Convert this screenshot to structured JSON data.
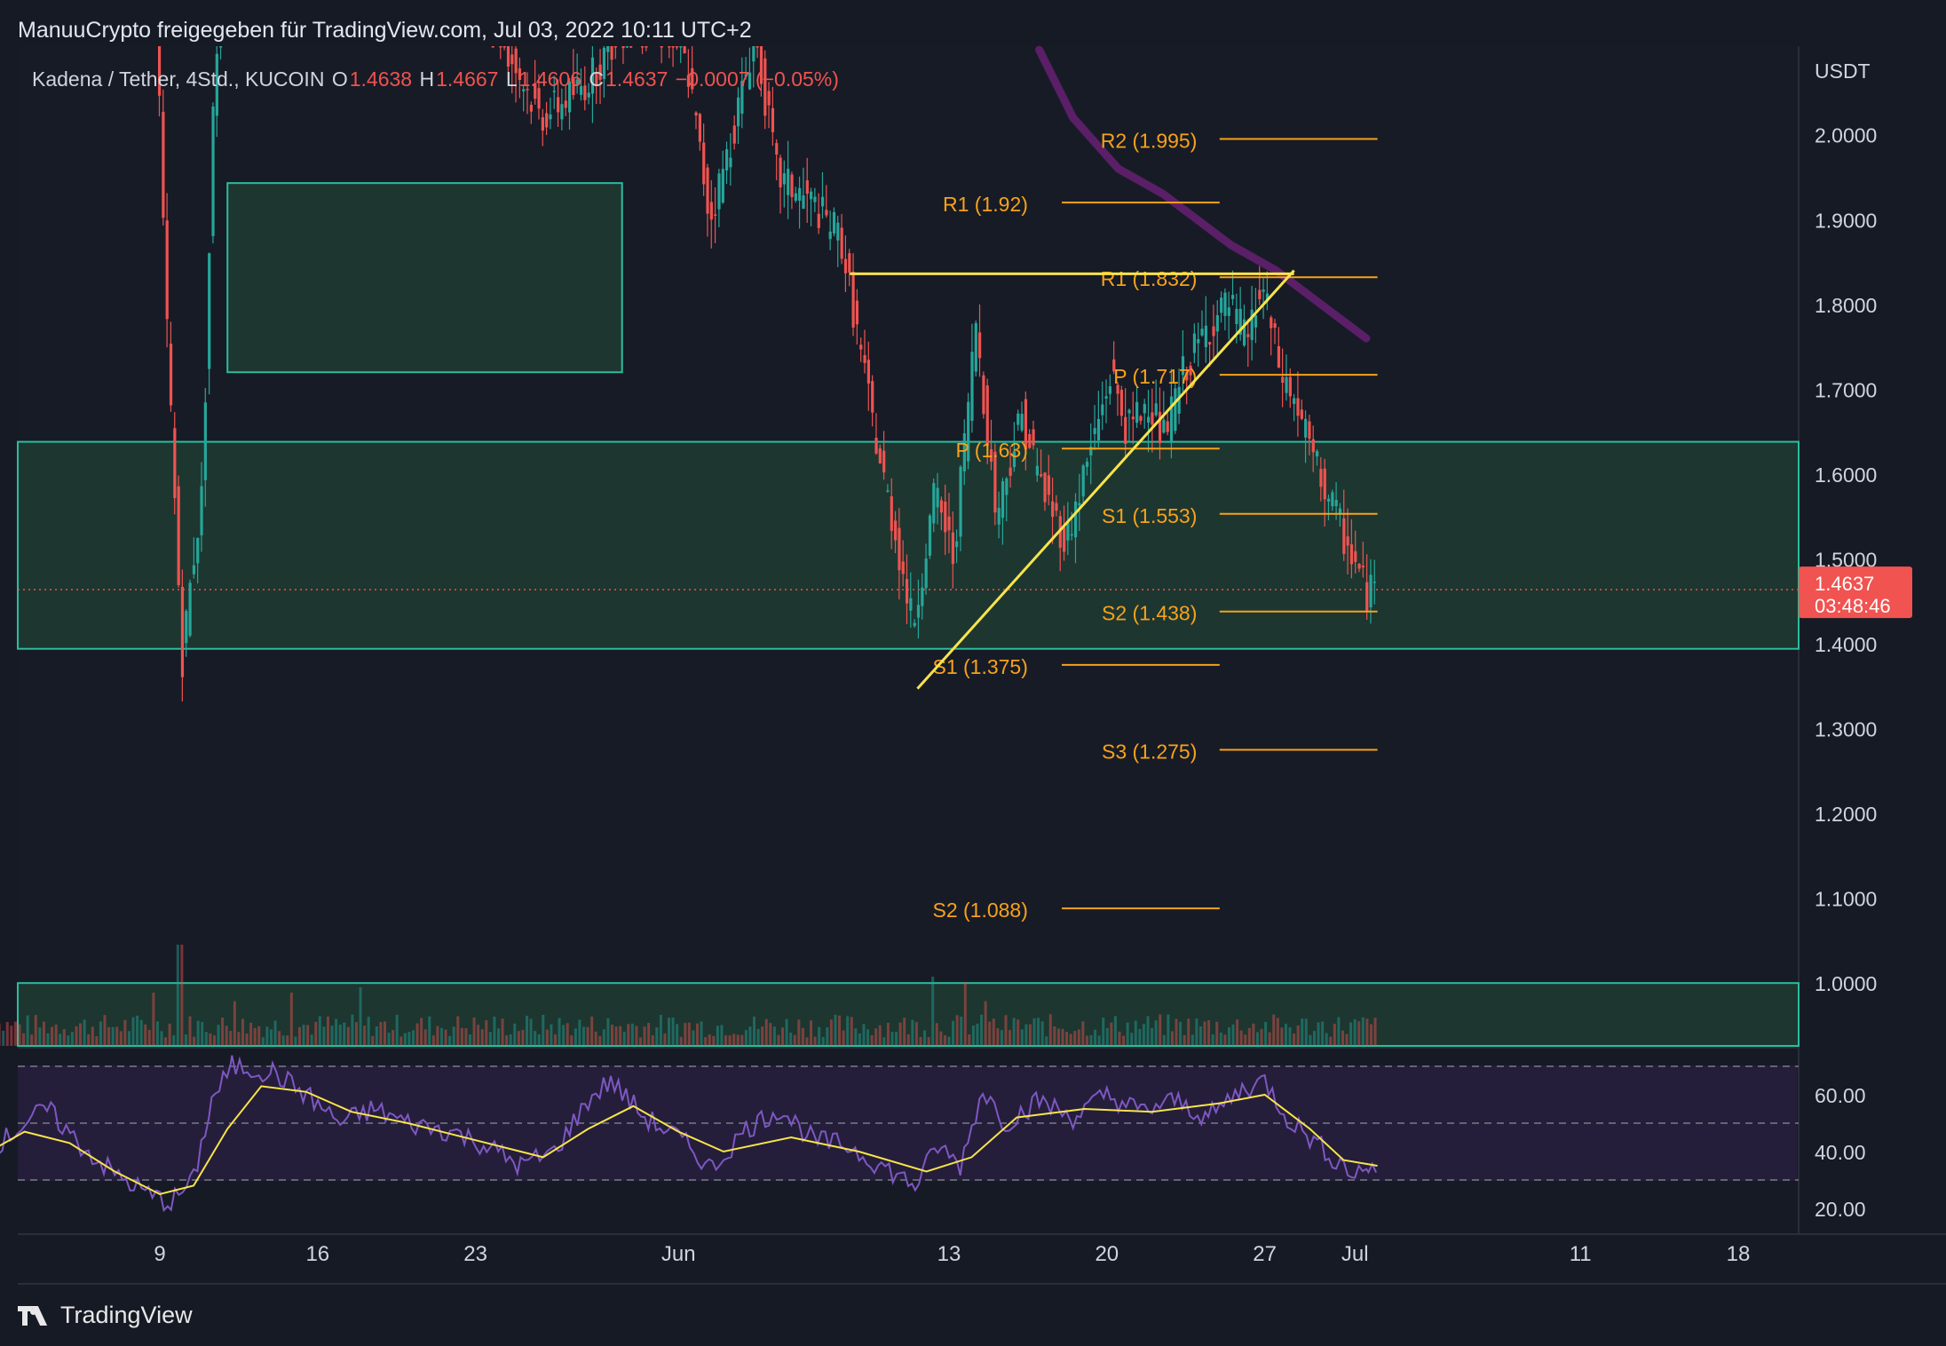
{
  "header": {
    "text": "ManuuCrypto freigegeben für TradingView.com, Jul 03, 2022 10:11 UTC+2"
  },
  "legend": {
    "symbol": "Kadena / Tether, 4Std., KUCOIN",
    "o_label": "O",
    "o_value": "1.4638",
    "h_label": "H",
    "h_value": "1.4667",
    "l_label": "L",
    "l_value": "1.4606",
    "c_label": "C",
    "c_value": "1.4637",
    "change": "−0.0007 (−0.05%)"
  },
  "footer": {
    "brand": "TradingView"
  },
  "colors": {
    "background": "#161a25",
    "up": "#26a69a",
    "down": "#ef5350",
    "zone": "#1f3b32",
    "zone_border": "#2bbd9e",
    "pivot": "#f7a21b",
    "trendline": "#f8e44a",
    "ma": "#5a1f66",
    "rsi": "#7e57c2",
    "rsi_ma": "#f8e44a"
  },
  "chart_data": {
    "type": "candlestick",
    "pair": "KDA/USDT",
    "currency_label": "USDT",
    "y_ticks": [
      "2.0000",
      "1.9000",
      "1.8000",
      "1.7000",
      "1.6000",
      "1.5000",
      "1.4000",
      "1.3000",
      "1.2000",
      "1.1000",
      "1.0000"
    ],
    "ylim": [
      0.92,
      2.1
    ],
    "x_ticks": [
      {
        "label": "9",
        "day": 9
      },
      {
        "label": "16",
        "day": 16
      },
      {
        "label": "23",
        "day": 23
      },
      {
        "label": "Jun",
        "day": 32
      },
      {
        "label": "13",
        "day": 44
      },
      {
        "label": "20",
        "day": 51
      },
      {
        "label": "27",
        "day": 58
      },
      {
        "label": "Jul",
        "day": 62
      },
      {
        "label": "11",
        "day": 72
      },
      {
        "label": "18",
        "day": 79
      }
    ],
    "last_price": {
      "value": "1.4637",
      "countdown": "03:48:46"
    },
    "zones": [
      {
        "from": 1.394,
        "to": 1.638
      },
      {
        "from": 0.92,
        "to": 1.0
      },
      {
        "from": 1.72,
        "to": 1.943,
        "start_day": 12,
        "end_day": 29.5
      }
    ],
    "pivot_sets": [
      {
        "start_day": 49.0,
        "end_day": 56.0,
        "label_day": 47.5,
        "levels": [
          {
            "label": "R1 (1.92)",
            "value": 1.92
          },
          {
            "label": "P (1.63)",
            "value": 1.63
          },
          {
            "label": "S1 (1.375)",
            "value": 1.375
          },
          {
            "label": "S2 (1.088)",
            "value": 1.088
          }
        ]
      },
      {
        "start_day": 56.0,
        "end_day": 63.0,
        "label_day": 55.0,
        "levels": [
          {
            "label": "R2 (1.995)",
            "value": 1.995
          },
          {
            "label": "R1 (1.832)",
            "value": 1.832
          },
          {
            "label": "P (1.717)",
            "value": 1.717
          },
          {
            "label": "S1 (1.553)",
            "value": 1.553
          },
          {
            "label": "S2 (1.438)",
            "value": 1.438
          },
          {
            "label": "S3 (1.275)",
            "value": 1.275
          }
        ]
      }
    ],
    "trendlines": [
      {
        "x1": 39.6,
        "y1": 1.836,
        "x2": 59.3,
        "y2": 1.836
      },
      {
        "x1": 42.6,
        "y1": 1.347,
        "x2": 59.3,
        "y2": 1.84
      }
    ],
    "moving_average": [
      {
        "day": 48.0,
        "value": 2.1
      },
      {
        "day": 49.5,
        "value": 2.02
      },
      {
        "day": 51.5,
        "value": 1.96
      },
      {
        "day": 53.5,
        "value": 1.93
      },
      {
        "day": 55.0,
        "value": 1.9
      },
      {
        "day": 56.5,
        "value": 1.87
      },
      {
        "day": 58.5,
        "value": 1.84
      },
      {
        "day": 60.5,
        "value": 1.8
      },
      {
        "day": 62.5,
        "value": 1.76
      }
    ],
    "key_price_path": [
      {
        "day": 1,
        "value": 2.23
      },
      {
        "day": 4,
        "value": 2.28
      },
      {
        "day": 7,
        "value": 2.24
      },
      {
        "day": 8.9,
        "value": 2.2
      },
      {
        "day": 9.3,
        "value": 1.85
      },
      {
        "day": 9.8,
        "value": 1.55
      },
      {
        "day": 10.1,
        "value": 1.38
      },
      {
        "day": 10.5,
        "value": 1.48
      },
      {
        "day": 11.0,
        "value": 1.58
      },
      {
        "day": 11.5,
        "value": 2.05
      },
      {
        "day": 12.0,
        "value": 2.25
      },
      {
        "day": 14,
        "value": 2.3
      },
      {
        "day": 18,
        "value": 2.3
      },
      {
        "day": 22,
        "value": 2.28
      },
      {
        "day": 24.5,
        "value": 2.1
      },
      {
        "day": 26,
        "value": 2.02
      },
      {
        "day": 28,
        "value": 2.06
      },
      {
        "day": 29.5,
        "value": 2.12
      },
      {
        "day": 31,
        "value": 2.15
      },
      {
        "day": 32.5,
        "value": 2.08
      },
      {
        "day": 33.5,
        "value": 1.9
      },
      {
        "day": 34.5,
        "value": 2.0
      },
      {
        "day": 35.5,
        "value": 2.12
      },
      {
        "day": 36.5,
        "value": 1.95
      },
      {
        "day": 38,
        "value": 1.92
      },
      {
        "day": 39.3,
        "value": 1.88
      },
      {
        "day": 40.2,
        "value": 1.74
      },
      {
        "day": 41.0,
        "value": 1.62
      },
      {
        "day": 41.8,
        "value": 1.52
      },
      {
        "day": 42.5,
        "value": 1.42
      },
      {
        "day": 43.5,
        "value": 1.58
      },
      {
        "day": 44.3,
        "value": 1.5
      },
      {
        "day": 45.3,
        "value": 1.78
      },
      {
        "day": 46.2,
        "value": 1.55
      },
      {
        "day": 47.3,
        "value": 1.67
      },
      {
        "day": 48.3,
        "value": 1.58
      },
      {
        "day": 49.3,
        "value": 1.52
      },
      {
        "day": 50.3,
        "value": 1.62
      },
      {
        "day": 51.3,
        "value": 1.72
      },
      {
        "day": 52.0,
        "value": 1.65
      },
      {
        "day": 53.0,
        "value": 1.69
      },
      {
        "day": 53.6,
        "value": 1.64
      },
      {
        "day": 54.5,
        "value": 1.72
      },
      {
        "day": 55.5,
        "value": 1.77
      },
      {
        "day": 56.5,
        "value": 1.8
      },
      {
        "day": 57.3,
        "value": 1.76
      },
      {
        "day": 58.0,
        "value": 1.82
      },
      {
        "day": 58.8,
        "value": 1.72
      },
      {
        "day": 59.5,
        "value": 1.68
      },
      {
        "day": 60.5,
        "value": 1.6
      },
      {
        "day": 61.0,
        "value": 1.57
      },
      {
        "day": 61.7,
        "value": 1.52
      },
      {
        "day": 62.2,
        "value": 1.49
      },
      {
        "day": 62.6,
        "value": 1.46
      },
      {
        "day": 63.0,
        "value": 1.4637
      }
    ],
    "volume": {
      "ylim": [
        0,
        1
      ],
      "spike_days": [
        8.6,
        9.8,
        12.2,
        14.8,
        17.8,
        43.2,
        44.6,
        45.6
      ],
      "spike_values": [
        0.5,
        0.95,
        0.42,
        0.5,
        0.55,
        0.65,
        0.6,
        0.42
      ]
    },
    "rsi": {
      "ylim": [
        15,
        75
      ],
      "ticks": [
        "60.00",
        "40.00",
        "20.00"
      ],
      "bands": [
        70,
        50,
        30
      ],
      "points": [
        {
          "day": 1,
          "value": 37
        },
        {
          "day": 3,
          "value": 50
        },
        {
          "day": 4,
          "value": 55
        },
        {
          "day": 5.5,
          "value": 42
        },
        {
          "day": 7,
          "value": 32
        },
        {
          "day": 8.5,
          "value": 25
        },
        {
          "day": 9.5,
          "value": 22
        },
        {
          "day": 10.5,
          "value": 30
        },
        {
          "day": 11.3,
          "value": 58
        },
        {
          "day": 12.2,
          "value": 70
        },
        {
          "day": 14,
          "value": 68
        },
        {
          "day": 15.5,
          "value": 60
        },
        {
          "day": 17,
          "value": 50
        },
        {
          "day": 18.5,
          "value": 55
        },
        {
          "day": 20,
          "value": 50
        },
        {
          "day": 22,
          "value": 47
        },
        {
          "day": 23.5,
          "value": 42
        },
        {
          "day": 25,
          "value": 35
        },
        {
          "day": 26.5,
          "value": 40
        },
        {
          "day": 28,
          "value": 58
        },
        {
          "day": 29,
          "value": 65
        },
        {
          "day": 30.5,
          "value": 52
        },
        {
          "day": 32,
          "value": 45
        },
        {
          "day": 33.5,
          "value": 34
        },
        {
          "day": 35,
          "value": 48
        },
        {
          "day": 36.5,
          "value": 55
        },
        {
          "day": 38,
          "value": 44
        },
        {
          "day": 39.5,
          "value": 42
        },
        {
          "day": 41,
          "value": 35
        },
        {
          "day": 42.5,
          "value": 28
        },
        {
          "day": 43.5,
          "value": 42
        },
        {
          "day": 44.5,
          "value": 35
        },
        {
          "day": 45.5,
          "value": 62
        },
        {
          "day": 46.5,
          "value": 50
        },
        {
          "day": 48,
          "value": 58
        },
        {
          "day": 49.5,
          "value": 52
        },
        {
          "day": 51,
          "value": 60
        },
        {
          "day": 52.5,
          "value": 54
        },
        {
          "day": 54,
          "value": 58
        },
        {
          "day": 55.5,
          "value": 52
        },
        {
          "day": 57,
          "value": 62
        },
        {
          "day": 58,
          "value": 65
        },
        {
          "day": 59,
          "value": 52
        },
        {
          "day": 60,
          "value": 45
        },
        {
          "day": 61,
          "value": 38
        },
        {
          "day": 62,
          "value": 32
        },
        {
          "day": 62.6,
          "value": 35
        },
        {
          "day": 63,
          "value": 34
        }
      ],
      "ma_points": [
        {
          "day": 1,
          "value": 38
        },
        {
          "day": 3,
          "value": 47
        },
        {
          "day": 5,
          "value": 43
        },
        {
          "day": 7,
          "value": 33
        },
        {
          "day": 9,
          "value": 25
        },
        {
          "day": 10.5,
          "value": 28
        },
        {
          "day": 12,
          "value": 48
        },
        {
          "day": 13.5,
          "value": 63
        },
        {
          "day": 15.5,
          "value": 61
        },
        {
          "day": 17.5,
          "value": 54
        },
        {
          "day": 20,
          "value": 50
        },
        {
          "day": 23,
          "value": 44
        },
        {
          "day": 26,
          "value": 38
        },
        {
          "day": 28,
          "value": 48
        },
        {
          "day": 30,
          "value": 56
        },
        {
          "day": 32,
          "value": 47
        },
        {
          "day": 34,
          "value": 40
        },
        {
          "day": 37,
          "value": 45
        },
        {
          "day": 40,
          "value": 40
        },
        {
          "day": 43,
          "value": 33
        },
        {
          "day": 45,
          "value": 38
        },
        {
          "day": 47,
          "value": 52
        },
        {
          "day": 50,
          "value": 55
        },
        {
          "day": 53,
          "value": 54
        },
        {
          "day": 56,
          "value": 57
        },
        {
          "day": 58,
          "value": 60
        },
        {
          "day": 60,
          "value": 48
        },
        {
          "day": 61.5,
          "value": 37
        },
        {
          "day": 63,
          "value": 35
        }
      ]
    }
  }
}
